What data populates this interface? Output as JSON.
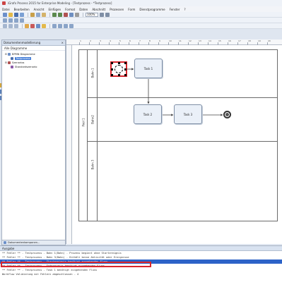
{
  "window": {
    "title": "iGrafx Process 2015 for Enterprise Modeling - [Testprozess - *Testprozess]"
  },
  "menu": [
    "Datei",
    "Bearbeiten",
    "Ansicht",
    "Einfügen",
    "Format",
    "Daten",
    "Abschnitt",
    "Prozessen",
    "Form",
    "Dienstprogramme",
    "Fenster",
    "?"
  ],
  "toolbar": {
    "zoom": "100%"
  },
  "left_panel": {
    "title": "Dokumentenmodellierung",
    "subtitle": "Alle Diagramme",
    "tree": [
      {
        "label": "BPMN Diagramme",
        "level": 0
      },
      {
        "label": "Testprozess",
        "level": 1,
        "selected": true
      },
      {
        "label": "Szenarios",
        "level": 0
      },
      {
        "label": "Standardszenario",
        "level": 1
      }
    ],
    "tab_label": "Dokumentenkomponen..."
  },
  "diagram": {
    "pool_label": "Pool 1",
    "lanes": [
      "Bahn 1",
      "Bahn2",
      "Bahn 3"
    ],
    "tasks": [
      "Task 1",
      "Task 2",
      "Task 3"
    ]
  },
  "ruler_numbers": [
    "1",
    "2",
    "3",
    "4",
    "5",
    "6",
    "7",
    "8",
    "9",
    "10",
    "11",
    "12",
    "13",
    "14",
    "15",
    "16",
    "17",
    "18",
    "19",
    "20"
  ],
  "output": {
    "title": "Ausgabe",
    "lines": [
      "** Fehler ** - Testprozess - Bahn 1(Bahn) - Prozess beginnt ohne Startereignis",
      "** Fehler ** - Testprozess - Bahn 3(Bahn) - Enthält keine Aktivität oder Ereignisse",
      "** Fehler ** - Testprozess - Startereignis benötigt ausgehenden Fluss",
      "** Fehler ** - Testprozess - Endereignis benötigt eingehenden Fluss",
      "** Fehler ** - Testprozess - Task 1 benötigt eingehenden Fluss",
      "Workflow Validierung mit Fehlern abgeschlossen - 4"
    ],
    "highlight_index": 2
  },
  "colors": {
    "selection_red": "#d9262b",
    "highlight_blue": "#2d63c8",
    "task_fill": "#eaf0f8"
  }
}
